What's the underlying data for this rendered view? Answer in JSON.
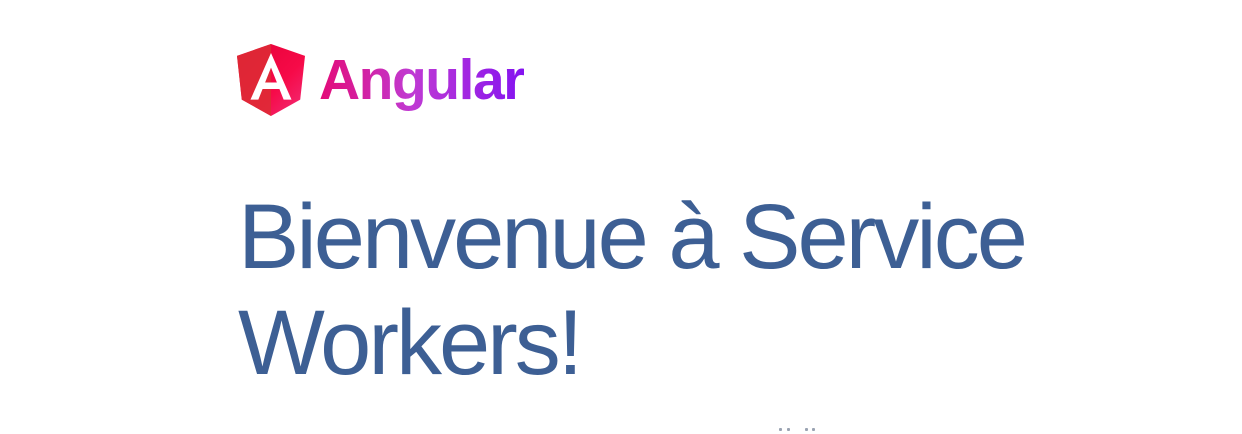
{
  "brand": {
    "name": "Angular",
    "logo_icon": "angular-shield-icon",
    "gradient": [
      "#e40b77",
      "#c03ad3",
      "#8413f0"
    ],
    "logo_colors": [
      "#e23237",
      "#b52e31",
      "#f54a67"
    ]
  },
  "hero": {
    "title_line1": "Bienvenue à Service",
    "title_line2": "Workers!",
    "title_color": "#3d5f94"
  },
  "background_color": "#ffffff"
}
